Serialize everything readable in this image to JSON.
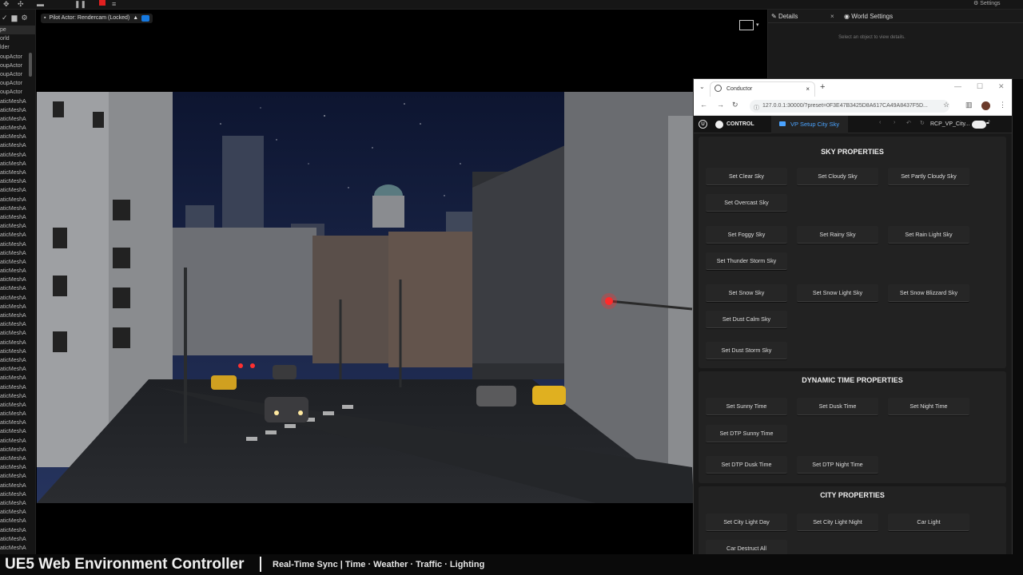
{
  "outliner": {
    "rows": [
      "pe",
      "orld",
      "lder",
      "oupActor",
      "oupActor",
      "oupActor",
      "oupActor",
      "oupActor",
      "aticMeshA",
      "aticMeshA",
      "aticMeshA",
      "aticMeshA",
      "aticMeshA",
      "aticMeshA",
      "aticMeshA",
      "aticMeshA",
      "aticMeshA",
      "aticMeshA",
      "aticMeshA",
      "aticMeshA",
      "aticMeshA",
      "aticMeshA",
      "aticMeshA",
      "aticMeshA",
      "aticMeshA",
      "aticMeshA",
      "aticMeshA",
      "aticMeshA",
      "aticMeshA",
      "aticMeshA",
      "aticMeshA",
      "aticMeshA",
      "aticMeshA",
      "aticMeshA",
      "aticMeshA",
      "aticMeshA",
      "aticMeshA",
      "aticMeshA",
      "aticMeshA",
      "aticMeshA",
      "aticMeshA",
      "aticMeshA",
      "aticMeshA",
      "aticMeshA",
      "aticMeshA",
      "aticMeshA",
      "aticMeshA",
      "aticMeshA",
      "aticMeshA",
      "aticMeshA",
      "aticMeshA",
      "aticMeshA",
      "aticMeshA",
      "aticMeshA",
      "aticMeshA",
      "aticMeshA",
      "aticMeshA",
      "aticMeshA",
      "aticMeshA",
      "aticMeshA"
    ]
  },
  "topbar": {
    "settings_label": "Settings"
  },
  "viewport": {
    "pilot_label": "Pilot Actor: Rendercam  (Locked)"
  },
  "details": {
    "tab_details": "Details",
    "tab_world": "World Settings",
    "hint": "Select an object to view details."
  },
  "browser": {
    "tab_title": "Conductor",
    "url": "127.0.0.1:30000/?preset=0F3E47B3425D8A617CA49A8437F5D...",
    "app": {
      "control_label": "CONTROL",
      "preset_tab": "VP Setup City Sky",
      "rcp_label": "RCP_VP_City..."
    }
  },
  "panels": {
    "sky": {
      "title": "SKY PROPERTIES",
      "buttons": [
        "Set Clear Sky",
        "Set Cloudy Sky",
        "Set Partly Cloudy Sky",
        "Set Overcast Sky",
        "Set Foggy Sky",
        "Set Rainy Sky",
        "Set Rain Light Sky",
        "Set Thunder Storm Sky",
        "Set Snow Sky",
        "Set Snow Light Sky",
        "Set Snow Blizzard Sky",
        "Set Dust Calm Sky",
        "Set Dust Storm Sky"
      ]
    },
    "time": {
      "title": "DYNAMIC TIME PROPERTIES",
      "buttons": [
        "Set Sunny Time",
        "Set Dusk Time",
        "Set Night Time",
        "Set DTP Sunny Time",
        "Set DTP Dusk Time",
        "Set DTP Night Time"
      ]
    },
    "city": {
      "title": "CITY PROPERTIES",
      "buttons": [
        "Set City Light Day",
        "Set City Light Night",
        "Car Light",
        "Car Destruct All"
      ]
    }
  },
  "caption": {
    "title": "UE5 Web Environment Controller",
    "subtitle": "Real-Time Sync | Time · Weather · Traffic · Lighting"
  },
  "colors": {
    "accent": "#4aa3ff",
    "pilot_cam": "#1679e0",
    "record": "#e02020"
  }
}
